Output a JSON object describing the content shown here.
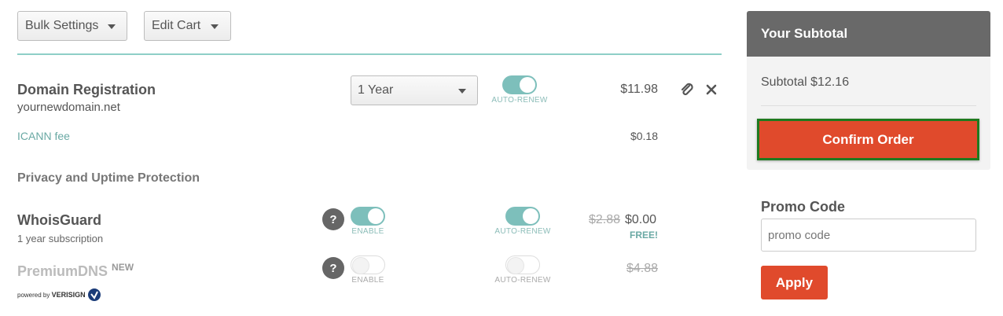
{
  "toolbar": {
    "bulk_settings": "Bulk Settings",
    "edit_cart": "Edit Cart"
  },
  "domain": {
    "title": "Domain Registration",
    "name": "yournewdomain.net",
    "term": "1 Year",
    "auto_renew_label": "AUTO-RENEW",
    "auto_renew_on": true,
    "price": "$11.98",
    "icann_label": "ICANN fee",
    "icann_price": "$0.18"
  },
  "privacy": {
    "section_title": "Privacy and Uptime Protection",
    "whoisguard": {
      "title": "WhoisGuard",
      "subtitle": "1 year subscription",
      "help": "?",
      "enable_label": "ENABLE",
      "enable_on": true,
      "auto_renew_label": "AUTO-RENEW",
      "auto_renew_on": true,
      "old_price": "$2.88",
      "price": "$0.00",
      "free_label": "FREE!"
    },
    "premiumdns": {
      "title": "PremiumDNS",
      "badge": "NEW",
      "help": "?",
      "enable_label": "ENABLE",
      "enable_on": false,
      "auto_renew_label": "AUTO-RENEW",
      "auto_renew_on": false,
      "price": "$4.88",
      "powered_by": "powered by",
      "powered_brand": "VERISIGN"
    }
  },
  "summary": {
    "header": "Your Subtotal",
    "subtotal": "Subtotal $12.16",
    "confirm_label": "Confirm Order",
    "promo_title": "Promo Code",
    "promo_placeholder": "promo code",
    "apply_label": "Apply"
  },
  "colors": {
    "accent_teal": "#7dbfbb",
    "confirm_orange": "#e04a2c",
    "highlight_green": "#1f7a1f",
    "panel_header": "#696969"
  },
  "icons": [
    "chevron-down-icon",
    "paperclip-icon",
    "close-icon",
    "help-icon",
    "verisign-logo"
  ]
}
